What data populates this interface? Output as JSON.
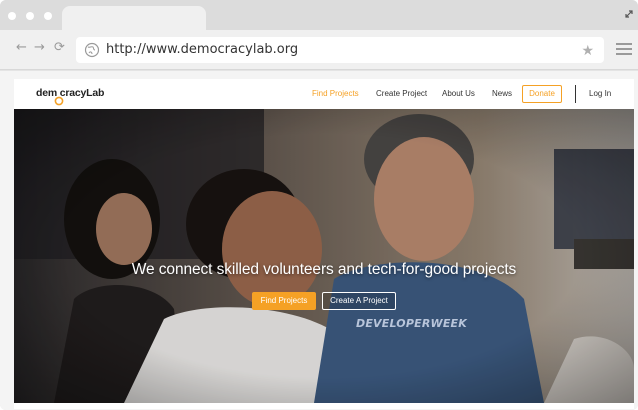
{
  "browser": {
    "nav": {
      "back": "←",
      "forward": "→",
      "reload": "⟳"
    },
    "url": "http://www.democracylab.org",
    "icons": [
      "globe-icon",
      "star-icon",
      "menu-icon",
      "expand-icon"
    ]
  },
  "site": {
    "logo_text": "dem cracyLab",
    "nav": {
      "find_projects": "Find Projects",
      "create_project": "Create Project",
      "about_us": "About Us",
      "news": "News",
      "donate": "Donate",
      "login": "Log In"
    },
    "hero": {
      "headline": "We connect skilled volunteers and tech-for-good projects",
      "find_button": "Find Projects",
      "create_button": "Create A Project",
      "shirt_text": "DEVELOPERWEEK"
    },
    "colors": {
      "accent": "#f5a125",
      "text": "#333333"
    }
  }
}
